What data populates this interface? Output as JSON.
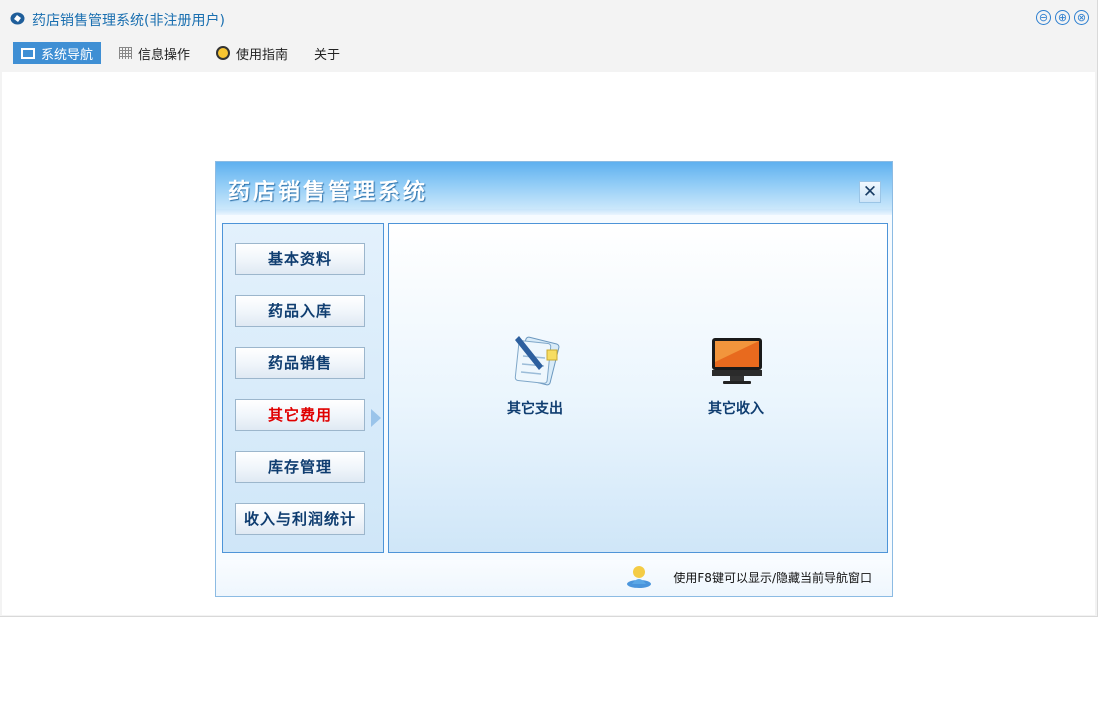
{
  "window": {
    "title": "药店销售管理系统(非注册用户)",
    "controls": [
      "⊖",
      "⊕",
      "⊗"
    ]
  },
  "menubar": {
    "items": [
      {
        "label": "系统导航",
        "icon": "monitor-icon",
        "active": true
      },
      {
        "label": "信息操作",
        "icon": "grid-icon",
        "active": false
      },
      {
        "label": "使用指南",
        "icon": "bulb-icon",
        "active": false
      },
      {
        "label": "关于",
        "icon": "",
        "active": false
      }
    ]
  },
  "nav_dialog": {
    "title": "药店销售管理系统",
    "close_label": "✕",
    "side_buttons": [
      {
        "label": "基本资料",
        "active": false
      },
      {
        "label": "药品入库",
        "active": false
      },
      {
        "label": "药品销售",
        "active": false
      },
      {
        "label": "其它费用",
        "active": true
      },
      {
        "label": "库存管理",
        "active": false
      },
      {
        "label": "收入与利润统计",
        "active": false
      }
    ],
    "main_items": [
      {
        "label": "其它支出",
        "icon": "notepad-icon"
      },
      {
        "label": "其它收入",
        "icon": "monitor-screen-icon"
      }
    ],
    "footer_hint": "使用F8键可以显示/隐藏当前导航窗口"
  },
  "colors": {
    "accent": "#3f8fd4",
    "title_text": "#1a6fb0",
    "active_button_text": "#e00000",
    "dialog_border": "#4d94d8"
  }
}
